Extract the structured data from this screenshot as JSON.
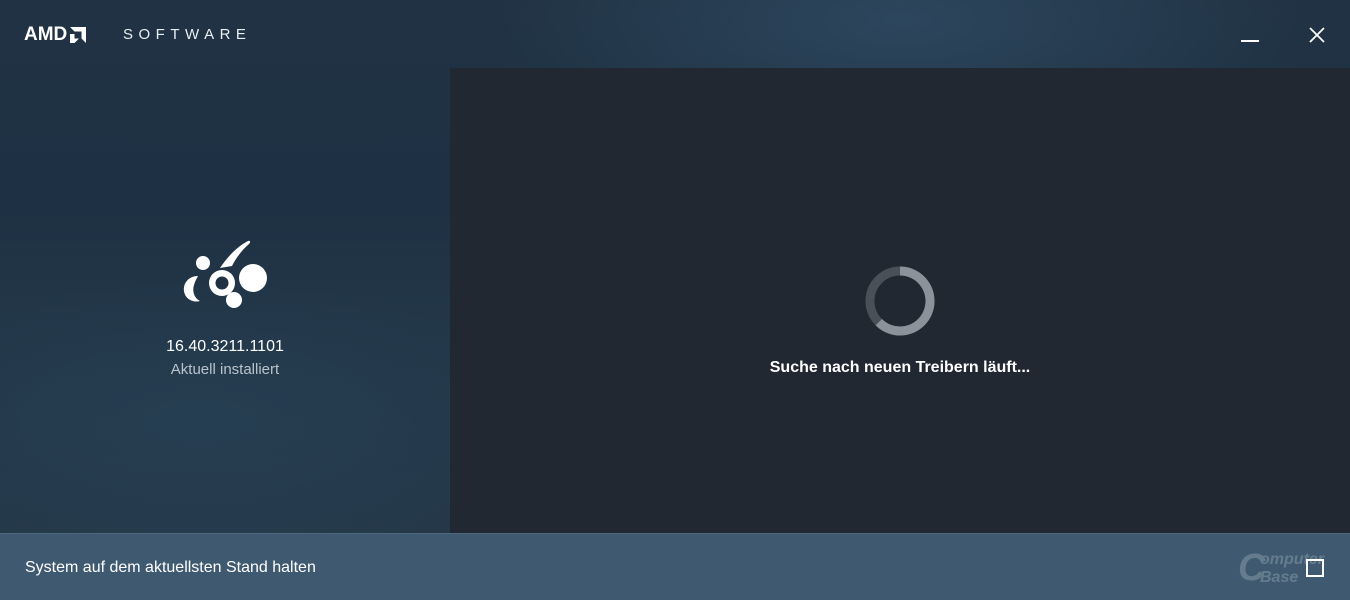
{
  "window": {
    "brand": "AMD",
    "product": "SOFTWARE",
    "controls": [
      "minimize-icon",
      "close-icon"
    ]
  },
  "driver": {
    "version": "16.40.3211.1101",
    "status_label": "Aktuell installiert",
    "icon": "radeon-driver-icon"
  },
  "search": {
    "status_text": "Suche nach neuen Treibern läuft...",
    "icon": "loading-spinner-icon"
  },
  "footer": {
    "keep_updated_label": "System auf dem aktuellsten Stand halten",
    "keep_updated_checked": false
  },
  "watermark": {
    "line1": "omputer",
    "line2": "Base"
  },
  "colors": {
    "accent_footer": "#3f5a70",
    "right_pane": "#222831",
    "spinner_track": "#4a5058",
    "spinner_arc": "#8c929a"
  }
}
